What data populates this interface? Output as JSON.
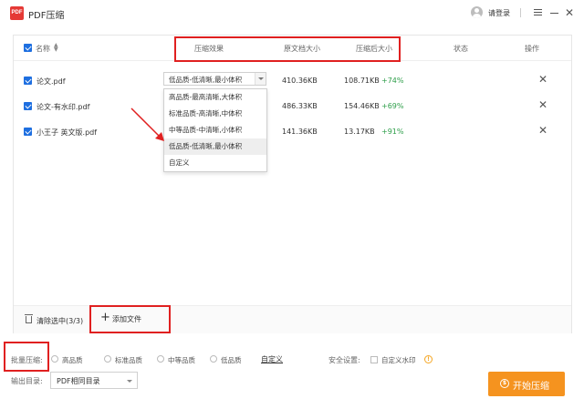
{
  "app": {
    "logo_text": "PDF",
    "title": "PDF压缩",
    "login_label": "请登录"
  },
  "colors": {
    "accent": "#1e6fe0",
    "success": "#2e9e4a",
    "primary_button": "#f5931f",
    "annotation": "#e02020"
  },
  "table": {
    "headers": {
      "name": "名称",
      "effect": "压缩效果",
      "original_size": "原文档大小",
      "compressed_size": "压缩后大小",
      "status": "状态",
      "action": "操作"
    },
    "rows": [
      {
        "name": "论文.pdf",
        "effect": "低品质-低清晰,最小体积",
        "original_size": "410.36KB",
        "compressed_size": "108.71KB",
        "reduction": "+74%"
      },
      {
        "name": "论文-有水印.pdf",
        "effect": "",
        "original_size": "486.33KB",
        "compressed_size": "154.46KB",
        "reduction": "+69%"
      },
      {
        "name": "小王子 英文版.pdf",
        "effect": "",
        "original_size": "141.36KB",
        "compressed_size": "13.17KB",
        "reduction": "+91%"
      }
    ]
  },
  "dropdown": {
    "options": [
      "高品质-最高清晰,大体积",
      "标准品质-高清晰,中体积",
      "中等品质-中清晰,小体积",
      "低品质-低清晰,最小体积",
      "自定义"
    ],
    "highlighted_index": 3
  },
  "footer": {
    "clear_label": "清除选中(3/3)",
    "add_label": "添加文件"
  },
  "options": {
    "batch_label": "批量压缩:",
    "radio_options": [
      "高品质",
      "标准品质",
      "中等品质",
      "低品质"
    ],
    "custom_label": "自定义",
    "security_label": "安全设置:",
    "watermark_label": "自定义水印",
    "output_label": "输出目录:",
    "output_value": "PDF相同目录"
  },
  "start_button": {
    "label": "开始压缩"
  }
}
